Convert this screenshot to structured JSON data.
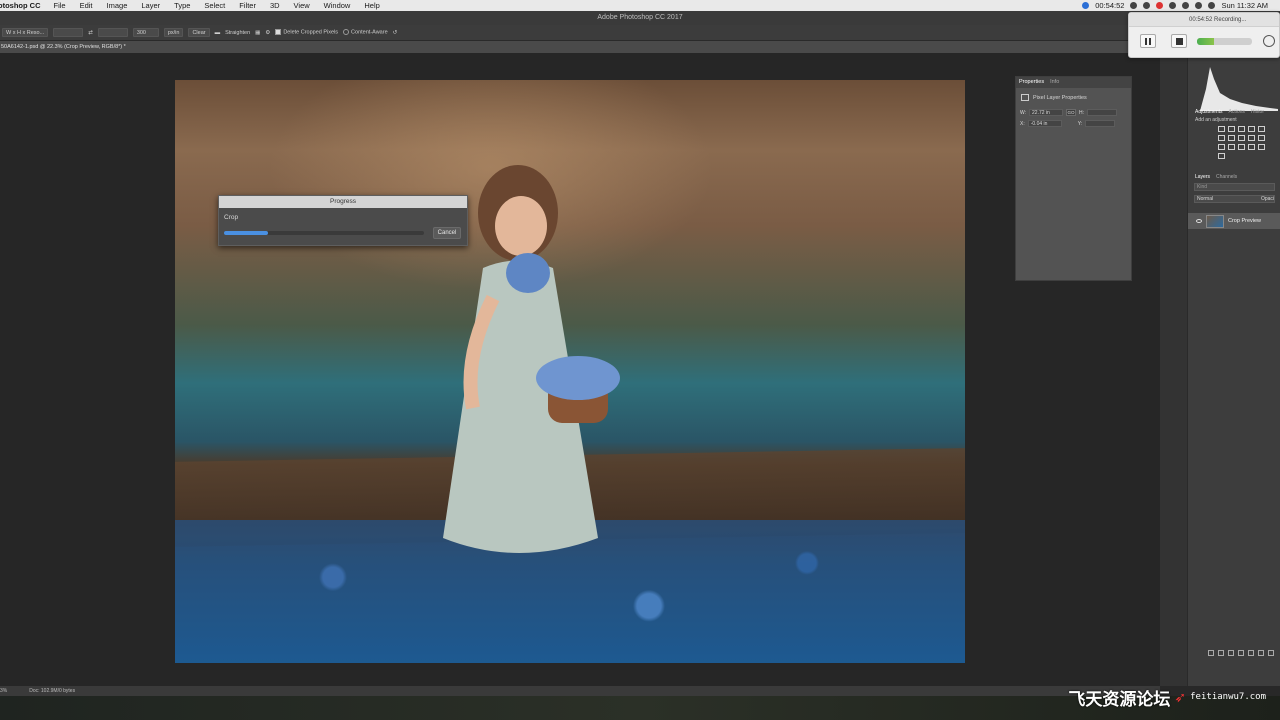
{
  "menubar": {
    "app": "otoshop CC",
    "items": [
      "File",
      "Edit",
      "Image",
      "Layer",
      "Type",
      "Select",
      "Filter",
      "3D",
      "View",
      "Window",
      "Help"
    ],
    "timer": "00:54:52",
    "clock": "Sun 11:32 AM"
  },
  "titlebar": {
    "title": "Adobe Photoshop CC 2017"
  },
  "options": {
    "ratio": "W x H x Reso...",
    "resolution": "300",
    "unit": "px/in",
    "clear": "Clear",
    "straighten": "Straighten",
    "delete_cropped": "Delete Cropped Pixels",
    "content_aware": "Content-Aware"
  },
  "doctab": {
    "label": "50A6142-1.psd @ 22.3% (Crop Preview, RGB/8*) *"
  },
  "progress": {
    "title": "Progress",
    "label": "Crop",
    "cancel": "Cancel",
    "fraction": 0.22
  },
  "properties": {
    "tab_properties": "Properties",
    "tab_info": "Info",
    "header": "Pixel Layer Properties",
    "w_label": "W:",
    "w_value": "22.72 in",
    "link": "GO",
    "h_label": "H:",
    "x_label": "X:",
    "x_value": "-0.04 in",
    "y_label": "Y:"
  },
  "dock": {
    "adj_tabs": [
      "Adjustments",
      "Actions",
      "Histor"
    ],
    "adj_sub": "Add an adjustment",
    "layer_tabs": [
      "Layers",
      "Channels"
    ],
    "kind": "Kind",
    "blend_mode": "Normal",
    "opacity": "Opaci",
    "layer_name": "Crop Preview"
  },
  "recording": {
    "label": "00:54:52 Recording...",
    "level_fraction": 0.3
  },
  "status": {
    "zoom": "3%",
    "doc": "Doc: 102.9M/0 bytes"
  },
  "watermark": {
    "chinese": "飞天资源论坛",
    "domain": "feitianwu7.com"
  }
}
